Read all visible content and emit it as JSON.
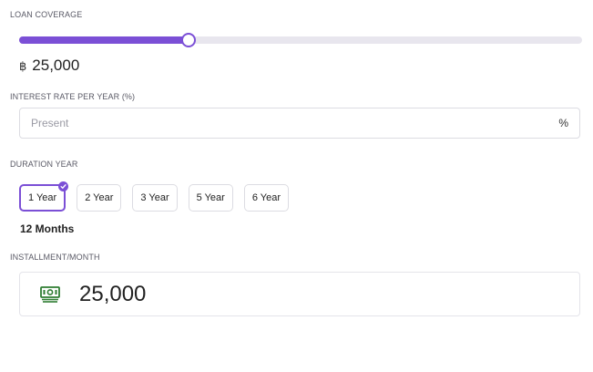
{
  "loan_coverage": {
    "label": "LOAN COVERAGE",
    "slider_fraction": 0.3,
    "currency_symbol": "฿",
    "amount": "25,000"
  },
  "interest_rate": {
    "label": "INTEREST RATE PER YEAR (%)",
    "placeholder": "Present",
    "value": "",
    "suffix": "%"
  },
  "duration": {
    "label": "DURATION YEAR",
    "options": [
      "1 Year",
      "2 Year",
      "3 Year",
      "5 Year",
      "6 Year"
    ],
    "selected_index": 0,
    "months_text": "12 Months"
  },
  "installment": {
    "label": "INSTALLMENT/MONTH",
    "icon": "money-icon",
    "value": "25,000"
  },
  "colors": {
    "accent": "#7b4fd6",
    "money_icon": "#2e7d32",
    "track": "#e8e6ee"
  }
}
